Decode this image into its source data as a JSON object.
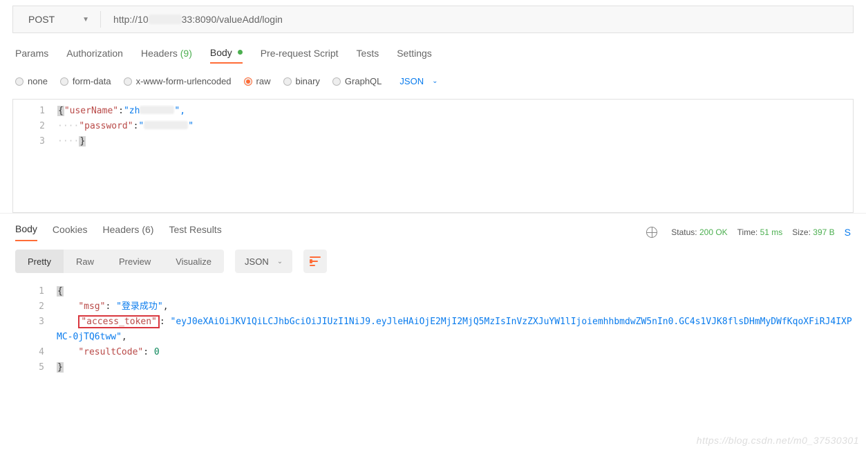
{
  "request": {
    "method": "POST",
    "url_prefix": "http://10",
    "url_suffix": "33:8090/valueAdd/login"
  },
  "req_tabs": {
    "params": "Params",
    "authorization": "Authorization",
    "headers": "Headers",
    "headers_count": "(9)",
    "body": "Body",
    "prerequest": "Pre-request Script",
    "tests": "Tests",
    "settings": "Settings"
  },
  "body_types": {
    "none": "none",
    "form_data": "form-data",
    "xwww": "x-www-form-urlencoded",
    "raw": "raw",
    "binary": "binary",
    "graphql": "GraphQL",
    "raw_type": "JSON"
  },
  "req_body": {
    "line1_key": "\"userName\"",
    "line1_val": "\"zh",
    "line1_val_end": "\",",
    "line2_key": "\"password\"",
    "line2_val_start": "\"",
    "line2_val_end": "\""
  },
  "resp_tabs": {
    "body": "Body",
    "cookies": "Cookies",
    "headers": "Headers",
    "headers_count": "(6)",
    "test_results": "Test Results"
  },
  "resp_meta": {
    "status_label": "Status:",
    "status_value": "200 OK",
    "time_label": "Time:",
    "time_value": "51 ms",
    "size_label": "Size:",
    "size_value": "397 B"
  },
  "resp_view": {
    "pretty": "Pretty",
    "raw": "Raw",
    "preview": "Preview",
    "visualize": "Visualize",
    "format": "JSON"
  },
  "resp_body": {
    "msg_key": "\"msg\"",
    "msg_val": "\"登录成功\"",
    "token_key": "\"access_token\"",
    "token_val": "\"eyJ0eXAiOiJKV1QiLCJhbGciOiJIUzI1NiJ9.eyJleHAiOjE2MjI2MjQ5MzIsInVzZXJuYW1lIjoiemhhbmdwZW5nIn0.GC4s1VJK8flsDHmMyDWfKqoXFiRJ4IXPMC-0jTQ6tww\"",
    "result_key": "\"resultCode\"",
    "result_val": "0"
  },
  "watermark": "https://blog.csdn.net/m0_37530301"
}
